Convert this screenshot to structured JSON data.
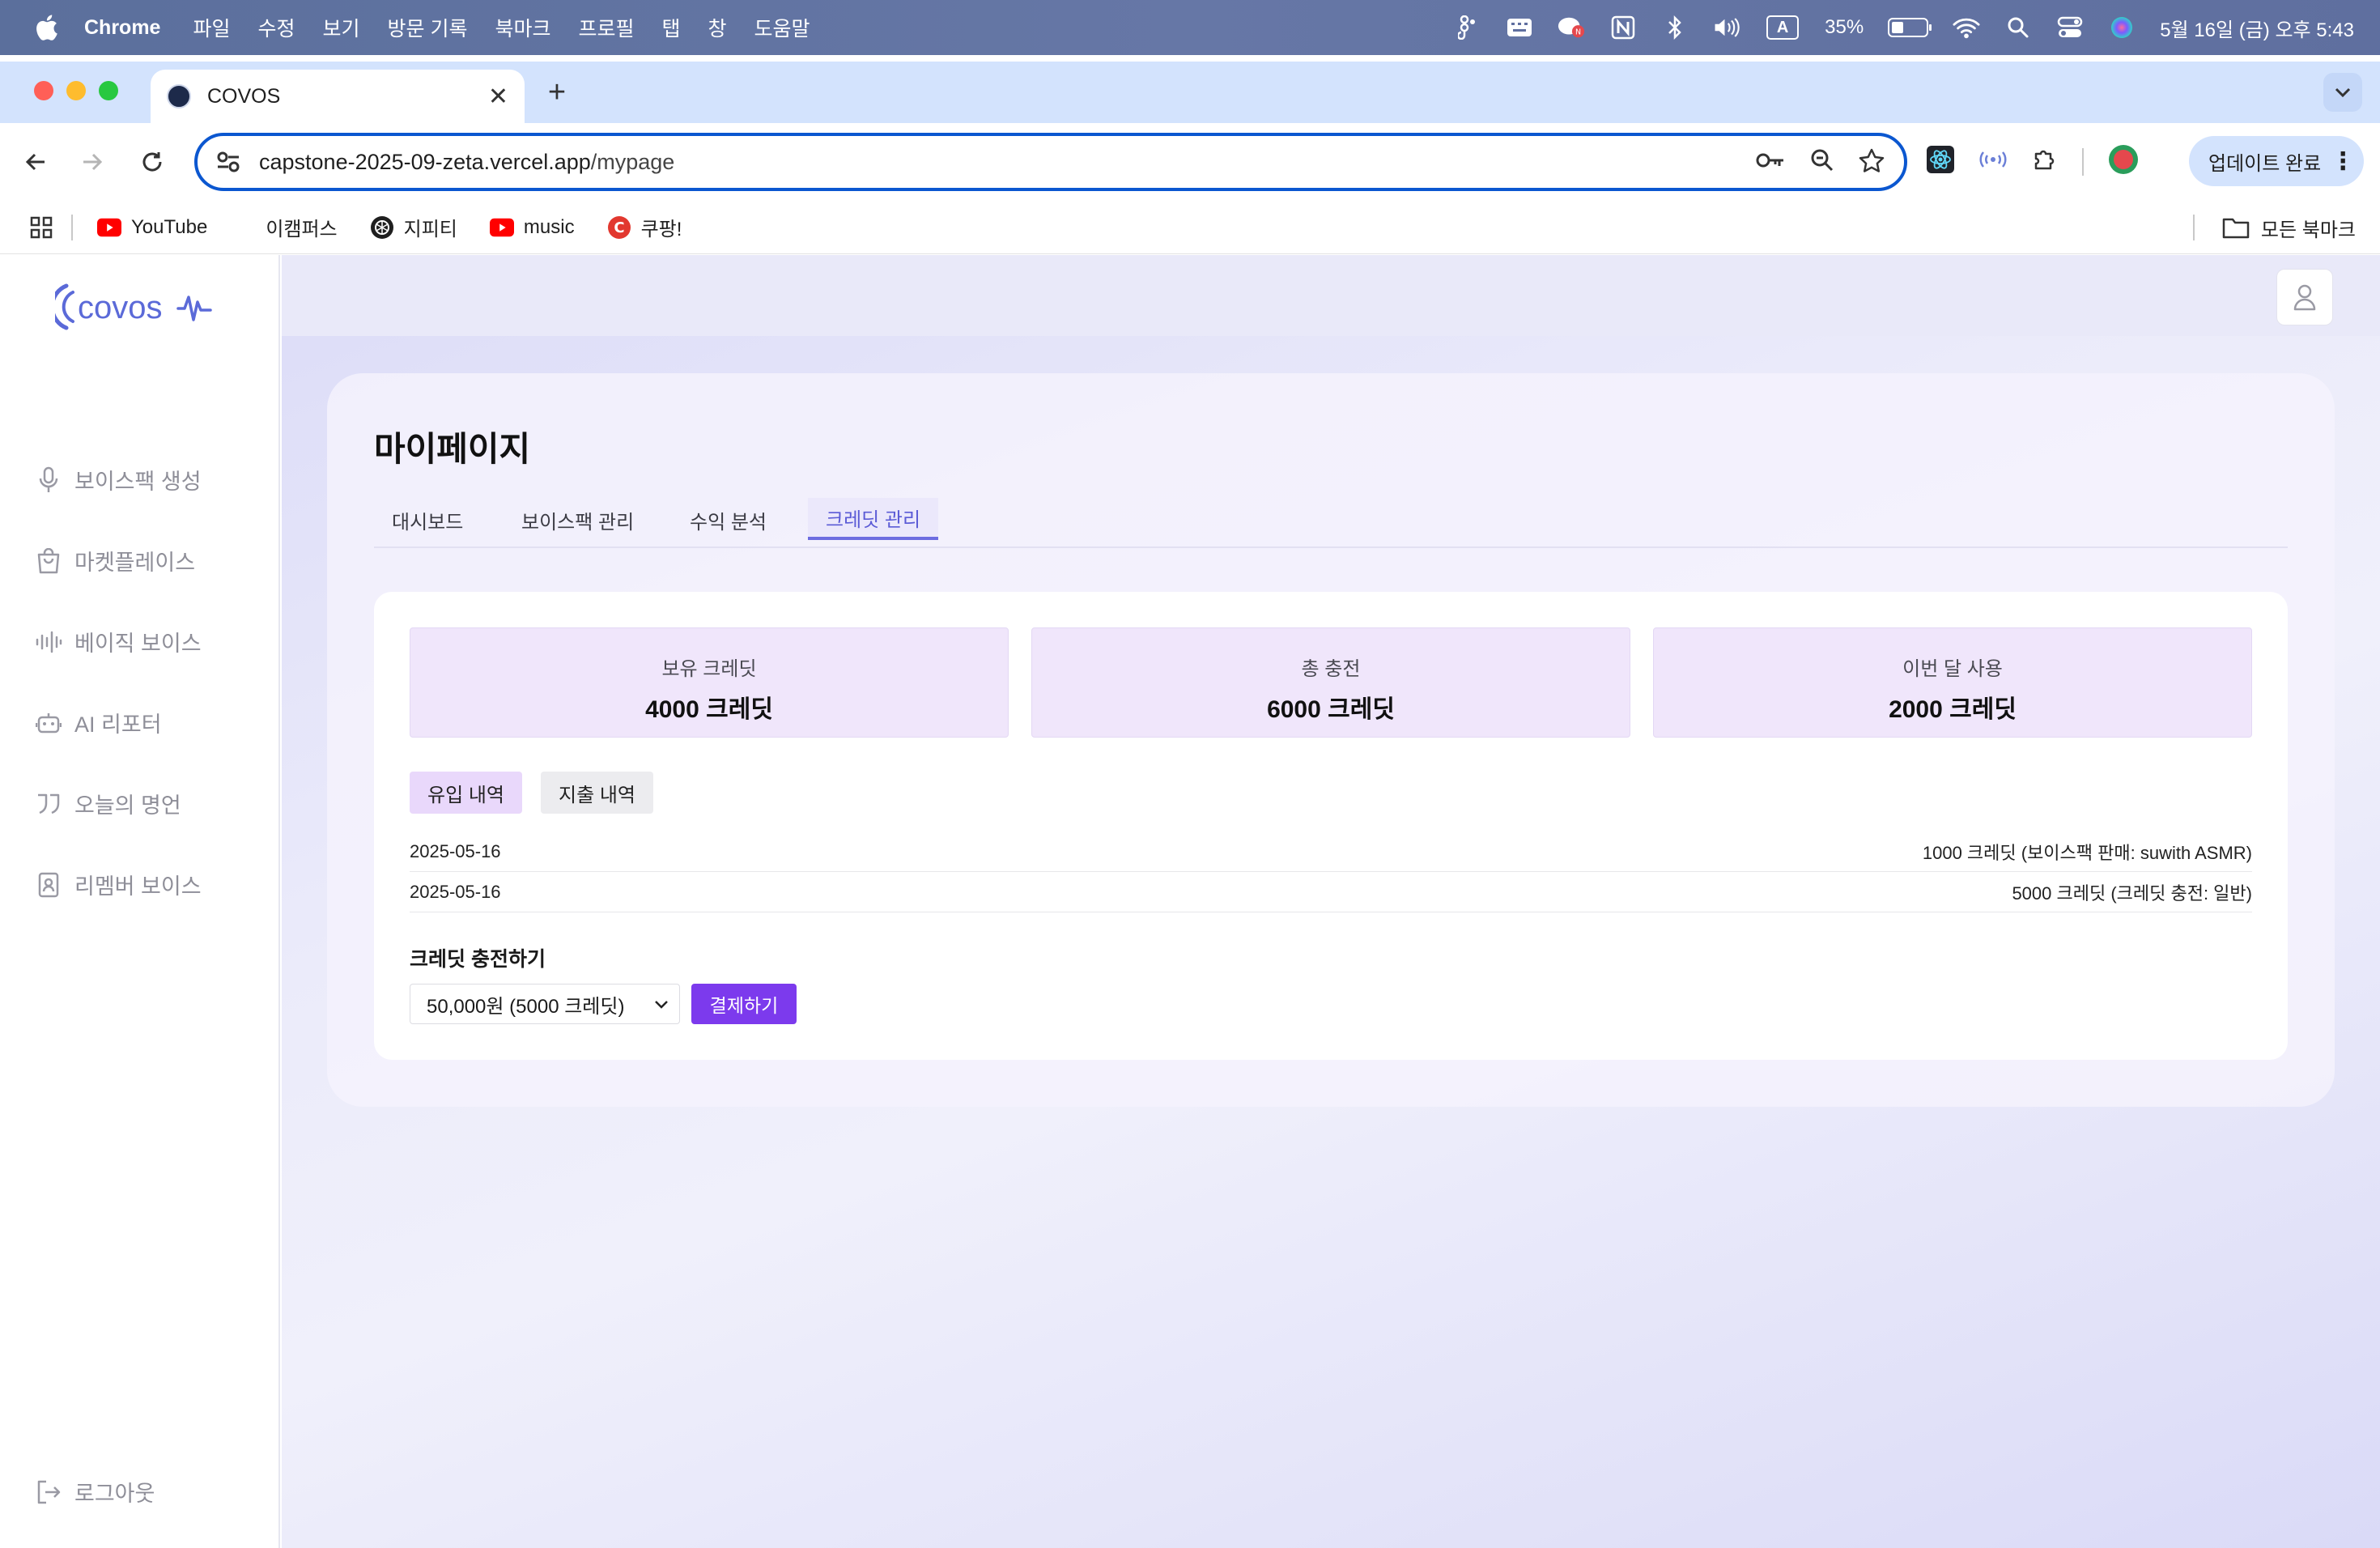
{
  "menubar": {
    "app_name": "Chrome",
    "items": [
      "파일",
      "수정",
      "보기",
      "방문 기록",
      "북마크",
      "프로필",
      "탭",
      "창",
      "도움말"
    ],
    "battery_percent": "35%",
    "battery_level": 0.35,
    "input_indicator": "A",
    "datetime": "5월 16일 (금) 오후 5:43"
  },
  "browser": {
    "tab_title": "COVOS",
    "url_host": "capstone-2025-09-zeta.vercel.app",
    "url_path": "/mypage",
    "update_button": "업데이트 완료",
    "bookmarks": [
      {
        "label": "YouTube",
        "icon": "youtube-icon"
      },
      {
        "label": "이캠퍼스",
        "icon": ""
      },
      {
        "label": "지피티",
        "icon": "openai-icon"
      },
      {
        "label": "music",
        "icon": "youtube-icon"
      },
      {
        "label": "쿠팡!",
        "icon": "coupang-icon"
      }
    ],
    "all_bookmarks": "모든 북마크"
  },
  "sidebar": {
    "logo_text": "covos",
    "items": [
      {
        "label": "보이스팩 생성",
        "icon": "microphone-icon"
      },
      {
        "label": "마켓플레이스",
        "icon": "shopping-bag-icon"
      },
      {
        "label": "베이직 보이스",
        "icon": "audio-wave-icon"
      },
      {
        "label": "AI 리포터",
        "icon": "robot-icon"
      },
      {
        "label": "오늘의 명언",
        "icon": "quote-icon"
      },
      {
        "label": "리멤버 보이스",
        "icon": "contact-book-icon"
      }
    ],
    "logout": "로그아웃"
  },
  "mypage": {
    "title": "마이페이지",
    "tabs": [
      "대시보드",
      "보이스팩 관리",
      "수익 분석",
      "크레딧 관리"
    ],
    "active_tab": "크레딧 관리",
    "stats": [
      {
        "label": "보유 크레딧",
        "value": "4000 크레딧"
      },
      {
        "label": "총 충전",
        "value": "6000 크레딧"
      },
      {
        "label": "이번 달 사용",
        "value": "2000 크레딧"
      }
    ],
    "history_tabs": [
      "유입 내역",
      "지출 내역"
    ],
    "active_history_tab": "유입 내역",
    "transactions": [
      {
        "date": "2025-05-16",
        "desc": "1000 크레딧 (보이스팩 판매: suwith ASMR)"
      },
      {
        "date": "2025-05-16",
        "desc": "5000 크레딧 (크레딧 충전: 일반)"
      }
    ],
    "charge_title": "크레딧 충전하기",
    "charge_selected": "50,000원 (5000 크레딧)",
    "pay_button": "결제하기"
  },
  "colors": {
    "accent": "#7c3aed",
    "tab_active": "#5b5bd6",
    "stat_bg": "#f0e6fb",
    "logo": "#5b6ad8"
  }
}
